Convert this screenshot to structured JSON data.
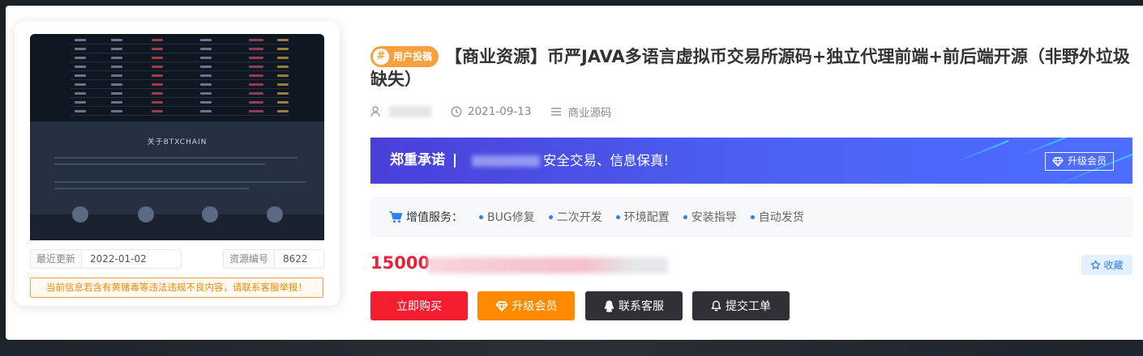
{
  "product": {
    "badge": "用户投稿",
    "title": "【商业资源】币严JAVA多语言虚拟币交易所源码+独立代理前端+前后端开源（非野外垃圾缺失）",
    "date": "2021-09-13",
    "category": "商业源码"
  },
  "preview": {
    "thumb_title": "关于BTXCHAIN",
    "updated_label": "最近更新",
    "updated_value": "2022-01-02",
    "id_label": "资源编号",
    "id_value": "8622",
    "warning": "当前信息若含有黄赌毒等违法违规不良内容，请联系客服举报！"
  },
  "banner": {
    "label": "郑重承诺",
    "message": "安全交易、信息保真!",
    "upgrade": "升级会员"
  },
  "services": {
    "label": "增值服务：",
    "items": [
      "BUG修复",
      "二次开发",
      "环境配置",
      "安装指导",
      "自动发货"
    ]
  },
  "price": {
    "amount": "15000",
    "favorite": "收藏"
  },
  "buttons": {
    "buy": "立即购买",
    "vip": "升级会员",
    "service": "联系客服",
    "ticket": "提交工单"
  },
  "colors": {
    "badge": "#f7a13c",
    "price": "#e8213a",
    "buy": "#f21d2e",
    "vip": "#ff8a00",
    "dark": "#2f3136",
    "accent": "#2e7cf6"
  },
  "icons": [
    "user-icon",
    "clock-icon",
    "list-icon",
    "cart-icon",
    "diamond-icon",
    "star-icon",
    "qq-penguin-icon",
    "bell-icon"
  ]
}
